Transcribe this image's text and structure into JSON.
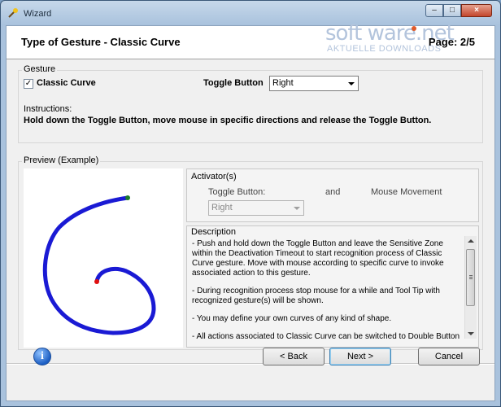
{
  "window": {
    "title": "Wizard",
    "min_glyph": "–",
    "max_glyph": "□",
    "close_glyph": "×"
  },
  "header": {
    "title": "Type of Gesture - Classic Curve",
    "page": "Page: 2/5"
  },
  "watermark": {
    "main": "soft ware.net",
    "sub": "AKTUELLE DOWNLOADS"
  },
  "gesture": {
    "group_label": "Gesture",
    "checkbox_label": "Classic Curve",
    "checkbox_mark": "✓",
    "toggle_label": "Toggle Button",
    "toggle_value": "Right",
    "instructions_label": "Instructions:",
    "instructions_text": "Hold down the Toggle Button, move mouse in specific directions and release the Toggle Button."
  },
  "preview": {
    "group_label": "Preview (Example)",
    "activators": {
      "label": "Activator(s)",
      "toggle_label": "Toggle Button:",
      "and_label": "and",
      "movement_label": "Mouse Movement",
      "toggle_value": "Right"
    },
    "description": {
      "label": "Description",
      "paragraphs": [
        "- Push and hold down the Toggle Button and leave the Sensitive Zone within the Deactivation Timeout to start recognition process of Classic Curve gesture. Move with mouse according to specific curve to invoke associated action to this gesture.",
        "- During recognition process stop mouse for a while and Tool Tip with recognized gesture(s) will be shown.",
        "- You may define your own curves of any kind of shape.",
        "- All actions associated to Classic Curve can be switched to Double Button"
      ]
    },
    "curve_colors": {
      "stroke": "#1a1ad4",
      "start": "#e01010",
      "end": "#1a7a2a"
    }
  },
  "footer": {
    "info_glyph": "i",
    "back": "< Back",
    "next": "Next >",
    "cancel": "Cancel"
  }
}
